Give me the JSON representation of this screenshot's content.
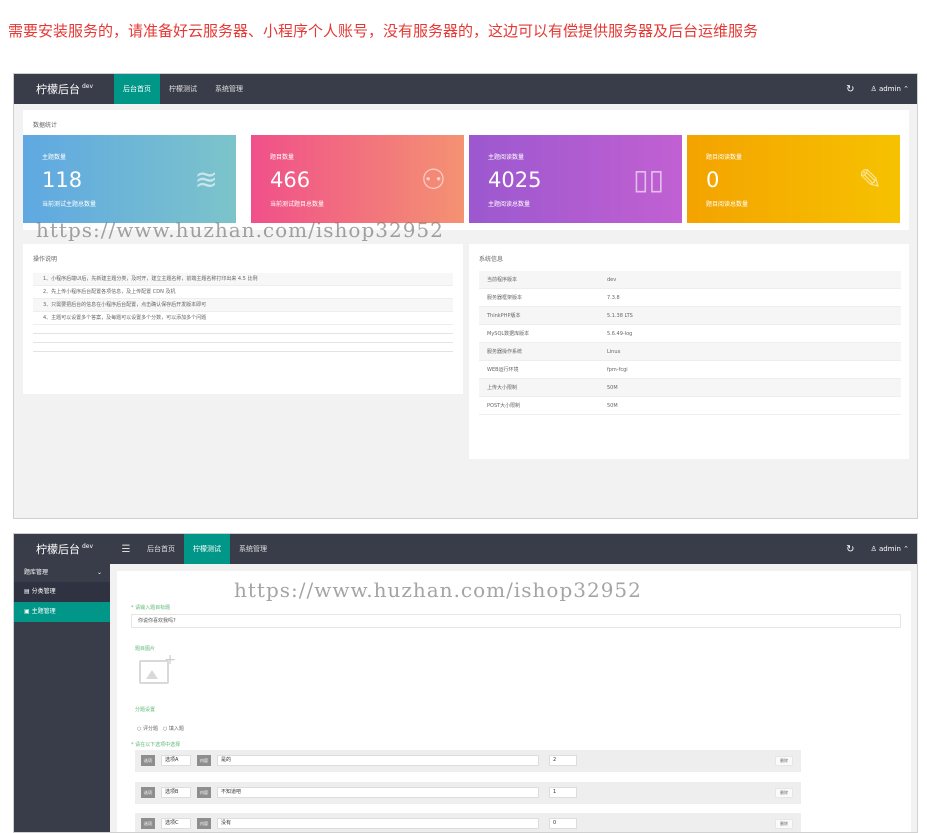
{
  "banner": "需要安装服务的，请准备好云服务器、小程序个人账号，没有服务器的，这边可以有偿提供服务器及后台运维服务",
  "app": {
    "brand": "柠檬后台",
    "env": "dev",
    "user": "admin",
    "user_icon": "user-icon",
    "refresh_icon": "refresh-icon"
  },
  "nav": {
    "home": "后台首页",
    "test": "柠檬测试",
    "system": "系统管理"
  },
  "watermark": "https://www.huzhan.com/ishop32952",
  "stats_section": {
    "title": "数据统计"
  },
  "stats": [
    {
      "label": "主题数量",
      "value": "118",
      "desc": "当前测试主题总数量",
      "icon": "layers-icon",
      "color": "#5fa8e2"
    },
    {
      "label": "题目数量",
      "value": "466",
      "desc": "当前测试题目总数量",
      "icon": "users-icon",
      "color": "#f0508a"
    },
    {
      "label": "主题阅读数量",
      "value": "4025",
      "desc": "主题阅读总数量",
      "icon": "book-icon",
      "color": "#9c58cf"
    },
    {
      "label": "题目阅读数量",
      "value": "0",
      "desc": "题目阅读总数量",
      "icon": "edit-icon",
      "color": "#f4a300"
    }
  ],
  "guide": {
    "title": "操作说明",
    "rows": [
      "1、小程序后端UI后，先新建主题分类，及时开，建立主题名称，前端主题名称打印出来 4.5 比例",
      "2、先上传小程序后台配置各项信息，及上传配置 CDN 及机",
      "3、只需要把后台的信息在小程序后台配置，点击确认保存后开发版本即可",
      "4、主题可以设置多个答案，及每题可以设置多个分数，可以添加多个问题"
    ]
  },
  "sysinfo": {
    "title": "系统信息",
    "rows": [
      {
        "k": "当前程序版本",
        "v": "dev"
      },
      {
        "k": "服务器框架版本",
        "v": "7.3.8"
      },
      {
        "k": "ThinkPHP版本",
        "v": "5.1.38 LTS"
      },
      {
        "k": "MySQL数据库版本",
        "v": "5.6.49-log"
      },
      {
        "k": "服务器操作系统",
        "v": "Linux"
      },
      {
        "k": "WEB运行环境",
        "v": "fpm-fcgi"
      },
      {
        "k": "上传大小限制",
        "v": "50M"
      },
      {
        "k": "POST大小限制",
        "v": "50M"
      }
    ]
  },
  "sidebar": {
    "group": "题库管理",
    "items": [
      {
        "label": "分类管理",
        "icon": "list-icon"
      },
      {
        "label": "主题管理",
        "icon": "document-icon"
      }
    ]
  },
  "form": {
    "title_label": "* 请输入题目标题",
    "title_value": "你说你喜欢我吗?",
    "image_label": "题目图片",
    "type_label": "分题设置",
    "type_options": [
      "○ 评分题",
      "○ 填入题"
    ],
    "options_label": "* 请在以下选项中选择",
    "rows": [
      {
        "tag": "选项",
        "name": "选项A",
        "content_tag": "内容",
        "content": "是的",
        "score": "2",
        "del": "删除"
      },
      {
        "tag": "选项",
        "name": "选项B",
        "content_tag": "内容",
        "content": "不知道吧",
        "score": "1",
        "del": "删除"
      },
      {
        "tag": "选项",
        "name": "选项C",
        "content_tag": "内容",
        "content": "没有",
        "score": "0",
        "del": "删除"
      }
    ]
  }
}
